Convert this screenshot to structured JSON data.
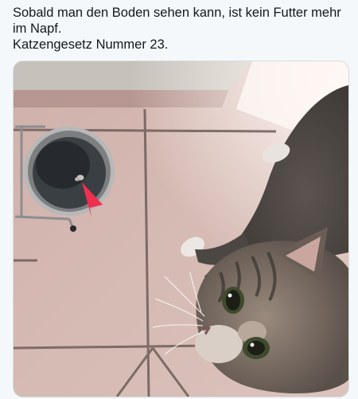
{
  "post": {
    "text_line1": "Sobald man den Boden sehen kann, ist kein Futter mehr im Napf.",
    "text_line2": "Katzengesetz Nummer 23."
  },
  "media": {
    "type": "photo",
    "subject": "tabby cat looking up beside an almost empty food bowl on a tiled floor, red arrow pointing at the visible bowl bottom",
    "arrow_color": "#ef2f4f",
    "floor_color": "#d6b6af",
    "bowl_color": "#3a3f44"
  }
}
